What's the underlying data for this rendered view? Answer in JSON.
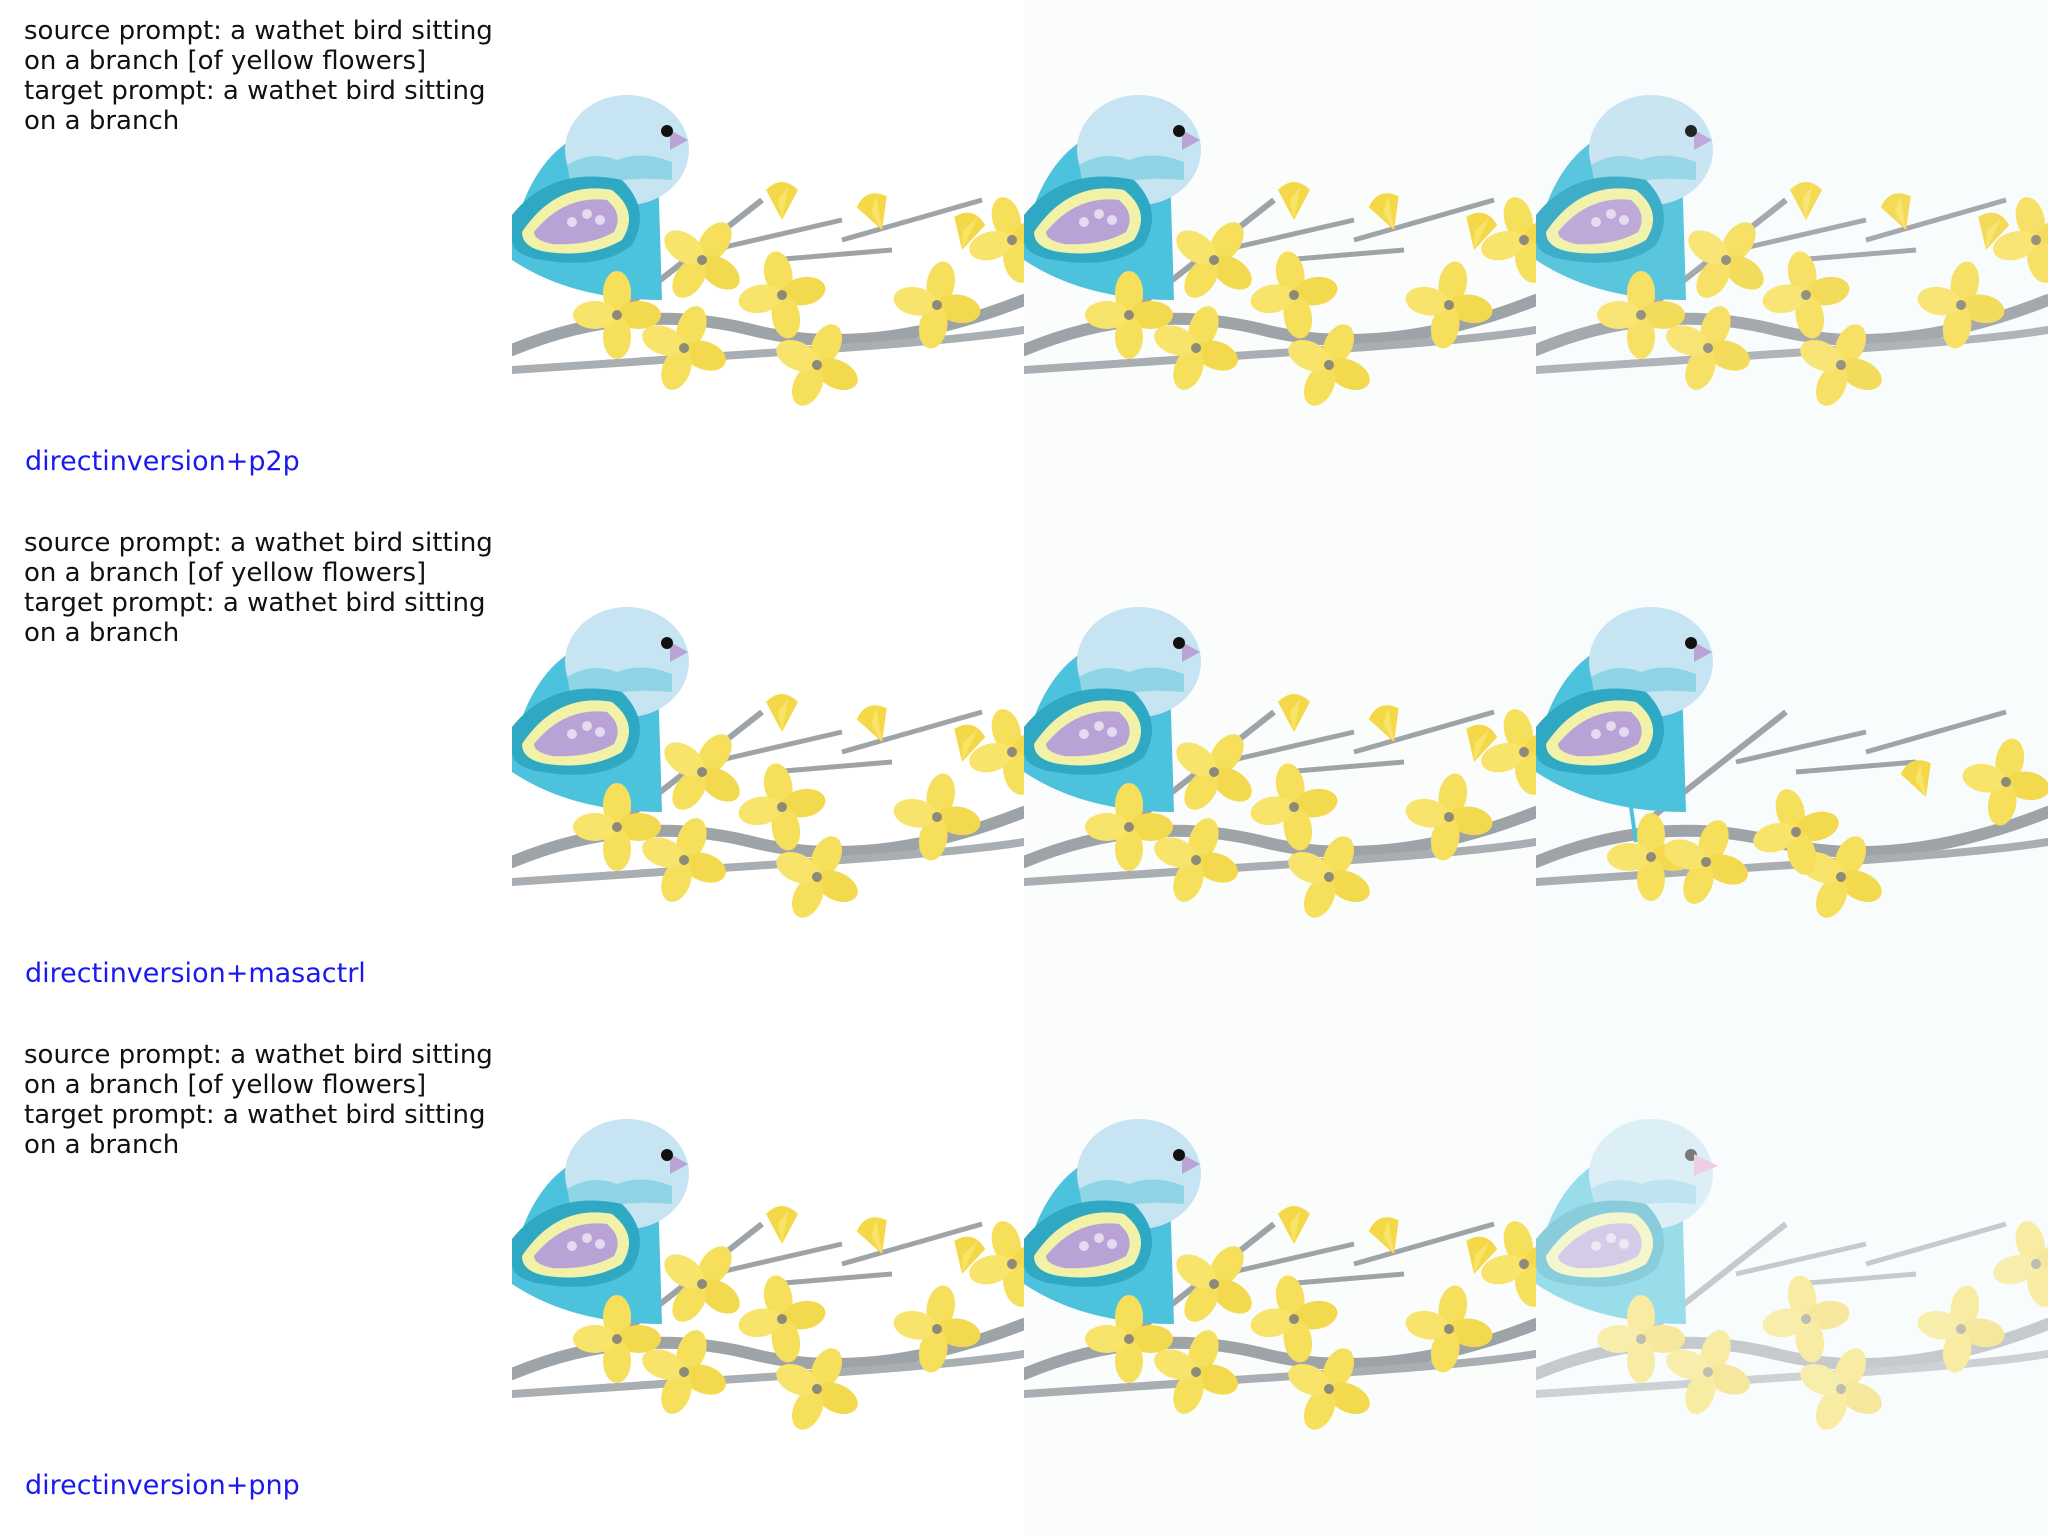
{
  "rows": [
    {
      "source_prompt": "source prompt: a wathet bird sitting on a branch [of yellow flowers]",
      "target_prompt": "target prompt: a wathet bird sitting on a branch",
      "method": "directinversion+p2p"
    },
    {
      "source_prompt": "source prompt: a wathet bird sitting on a branch [of yellow flowers]",
      "target_prompt": "target prompt: a wathet bird sitting on a branch",
      "method": "directinversion+masactrl"
    },
    {
      "source_prompt": "source prompt: a wathet bird sitting on a branch [of yellow flowers]",
      "target_prompt": "target prompt: a wathet bird sitting on a branch",
      "method": "directinversion+pnp"
    }
  ],
  "colors": {
    "method_label": "#1a1aee",
    "bird_head": "#c6e4f2",
    "bird_body": "#4cc2dc",
    "wing": "#b9a3d6",
    "flower": "#f6df5a",
    "branch": "#9ea3a8"
  }
}
